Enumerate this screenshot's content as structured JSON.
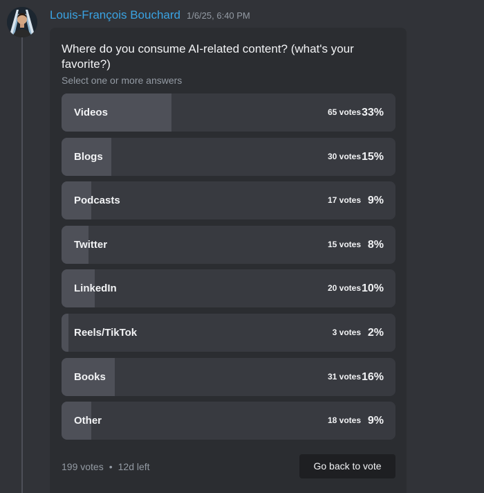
{
  "message": {
    "author": "Louis-François Bouchard",
    "timestamp": "1/6/25, 6:40 PM",
    "avatar_icon": "user-avatar"
  },
  "poll": {
    "question": "Where do you consume AI-related content? (what's your favorite?)",
    "subtitle": "Select one or more answers",
    "options": [
      {
        "label": "Videos",
        "votes": "65 votes",
        "percent": "33%",
        "share": 0.33
      },
      {
        "label": "Blogs",
        "votes": "30 votes",
        "percent": "15%",
        "share": 0.15
      },
      {
        "label": "Podcasts",
        "votes": "17 votes",
        "percent": "9%",
        "share": 0.09
      },
      {
        "label": "Twitter",
        "votes": "15 votes",
        "percent": "8%",
        "share": 0.08
      },
      {
        "label": "LinkedIn",
        "votes": "20 votes",
        "percent": "10%",
        "share": 0.1
      },
      {
        "label": "Reels/TikTok",
        "votes": "3 votes",
        "percent": "2%",
        "share": 0.02
      },
      {
        "label": "Books",
        "votes": "31 votes",
        "percent": "16%",
        "share": 0.16
      },
      {
        "label": "Other",
        "votes": "18 votes",
        "percent": "9%",
        "share": 0.09
      }
    ],
    "total_votes": "199 votes",
    "separator": "•",
    "time_left": "12d left",
    "vote_button_label": "Go back to vote"
  },
  "colors": {
    "background": "#313338",
    "poll_background": "#2b2d31",
    "option_background": "#383a40",
    "option_fill": "#4e5058",
    "username": "#3aa3e3"
  }
}
